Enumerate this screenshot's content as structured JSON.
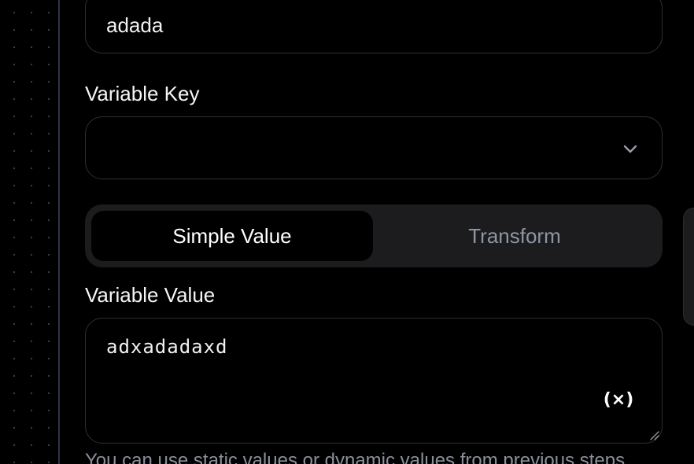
{
  "form": {
    "name_value": "adada",
    "variable_key": {
      "label": "Variable Key",
      "value": "",
      "chevron_icon": "chevron-down-icon"
    },
    "mode_toggle": {
      "options": [
        "Simple Value",
        "Transform"
      ],
      "selected": "Simple Value"
    },
    "variable_value": {
      "label": "Variable Value",
      "value": "adxadadaxd",
      "insert_variable_icon": "(×)"
    },
    "help_text": "You can use static values or dynamic values from previous steps"
  },
  "colors": {
    "background": "#000000",
    "field_border": "#2f2f33",
    "segment_bg": "#1c1c1e",
    "inactive_text": "#8e95a3",
    "help_text": "#8a8f9a"
  }
}
